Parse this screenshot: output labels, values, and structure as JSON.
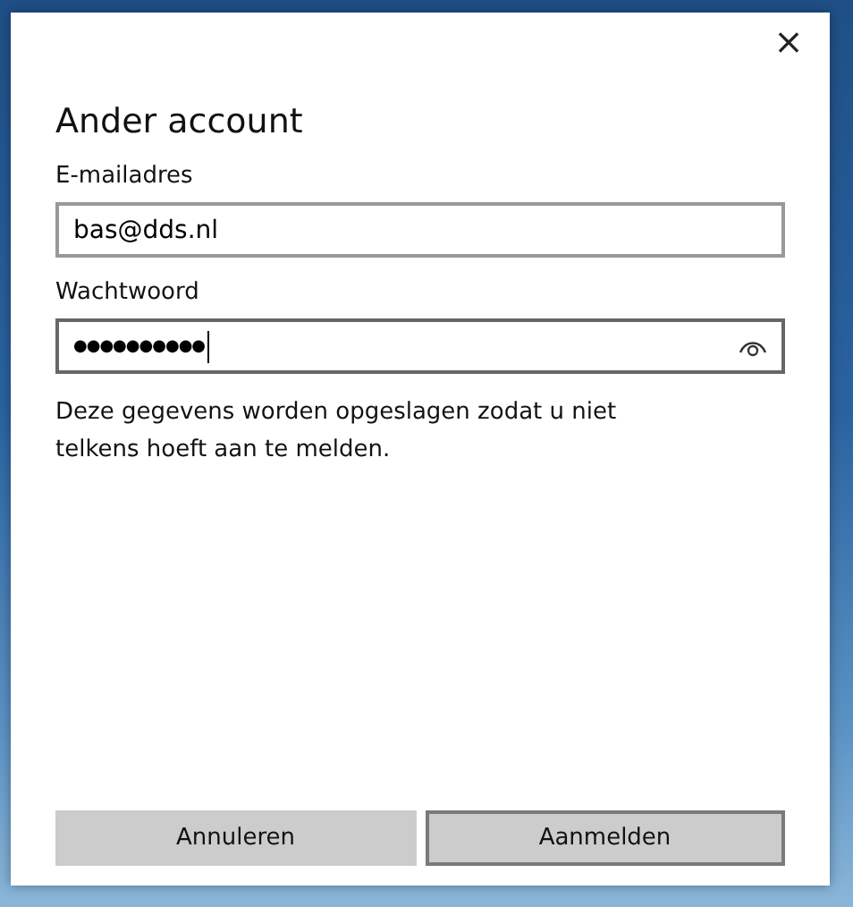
{
  "dialog": {
    "close_glyph": "×",
    "title": "Ander account",
    "fields": [
      {
        "label": "E-mailadres",
        "value": "bas@dds.nl",
        "kind": "text",
        "focused": false
      },
      {
        "label": "Wachtwoord",
        "value": "●●●●●●●●●●",
        "kind": "password",
        "focused": true
      }
    ],
    "note": "Deze gegevens worden opgeslagen zodat u niet telkens hoeft aan te melden.",
    "buttons": [
      {
        "label": "Annuleren",
        "focused": false
      },
      {
        "label": "Aanmelden",
        "focused": true
      }
    ]
  }
}
